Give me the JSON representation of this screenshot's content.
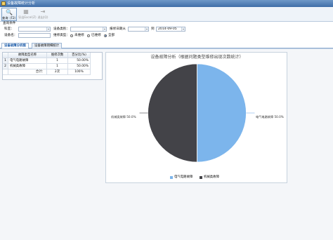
{
  "window": {
    "title": "设备故障统计分析"
  },
  "toolbar": {
    "query_label": "查询（F2）",
    "export_label": "导出Excel(Z)",
    "exit_label": "退出(Q)"
  },
  "query": {
    "section_title": "查询条件",
    "department_label": "科室：",
    "department_value": "",
    "category_label": "设备类别：",
    "category_value": "",
    "report_date_label": "报修日期从",
    "report_date_from": "",
    "to_label": "到",
    "report_date_to": "2014-09-05",
    "device_name_label": "设备名：",
    "device_name_value": "",
    "repair_type_label": "维修类型：",
    "options": [
      "未维修",
      "已维修",
      "全部"
    ],
    "selected_option": "全部"
  },
  "tabs": [
    {
      "label": "设备故障分析图",
      "active": true
    },
    {
      "label": "设备故障明细统计",
      "active": false
    }
  ],
  "table": {
    "columns": [
      "故障类型名称",
      "维修次数",
      "百分比(%)"
    ],
    "rows": [
      {
        "index": "1",
        "name": "电气电路故障",
        "count": "1",
        "percent": "50.00%"
      },
      {
        "index": "2",
        "name": "机械类故障",
        "count": "1",
        "percent": "50.00%"
      }
    ],
    "footer": {
      "label": "合计：",
      "count": "2次",
      "percent": "100%"
    }
  },
  "chart_data": {
    "type": "pie",
    "title": "设备故障分析（根据问题类型维修出现次数统计）",
    "labels": [
      "电气电路故障",
      "机械类故障"
    ],
    "values": [
      1,
      1
    ],
    "percent_labels": [
      "电气电路故障 50.0%",
      "机械类故障 50.0%"
    ],
    "colors": [
      "#7cb5ec",
      "#434348"
    ],
    "legend_position": "bottom"
  }
}
